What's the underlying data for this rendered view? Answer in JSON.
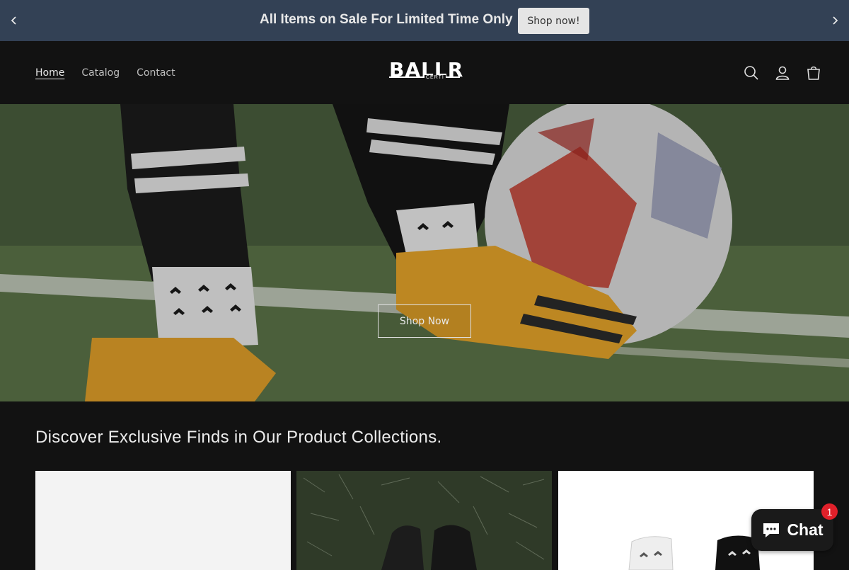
{
  "announcement": {
    "message": "All Items on Sale For Limited Time Only",
    "button_label": "Shop now!",
    "bg_color": "#334155"
  },
  "header": {
    "nav": [
      {
        "label": "Home",
        "active": true
      },
      {
        "label": "Catalog",
        "active": false
      },
      {
        "label": "Contact",
        "active": false
      }
    ],
    "logo": {
      "word": "BALLR",
      "sub": "CERTI"
    },
    "icons": [
      "search-icon",
      "account-icon",
      "cart-icon"
    ]
  },
  "hero": {
    "cta_label": "Shop Now"
  },
  "collections": {
    "heading": "Discover Exclusive Finds in Our Product Collections.",
    "cards": [
      "collection-card-blank",
      "collection-card-shin-guards",
      "collection-card-grip-socks"
    ]
  },
  "chat": {
    "label": "Chat",
    "badge": "1"
  }
}
